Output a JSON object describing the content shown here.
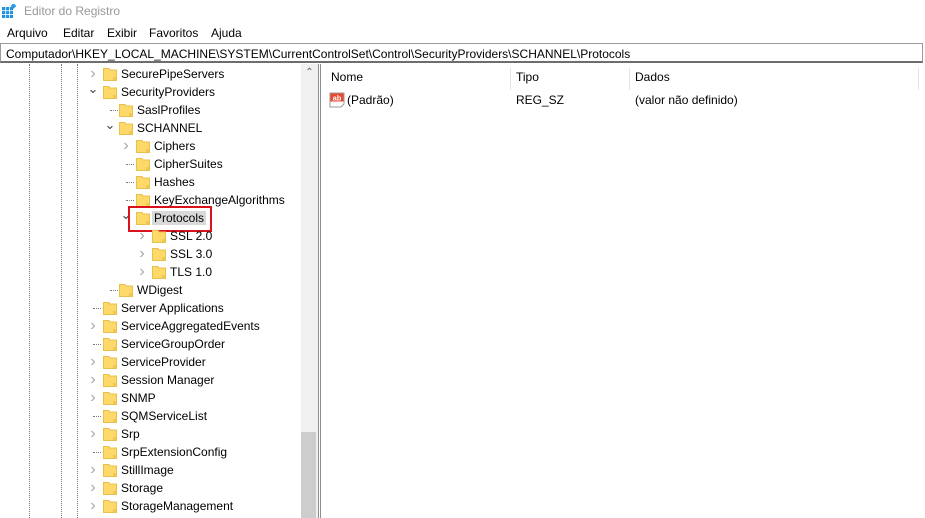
{
  "window": {
    "title": "Editor do Registro",
    "accent": "#0078d7"
  },
  "menu": [
    "Arquivo",
    "Editar",
    "Exibir",
    "Favoritos",
    "Ajuda"
  ],
  "address": "Computador\\HKEY_LOCAL_MACHINE\\SYSTEM\\CurrentControlSet\\Control\\SecurityProviders\\SCHANNEL\\Protocols",
  "tree": [
    {
      "label": "SecurePipeServers",
      "level": 0,
      "expander": "collapsed"
    },
    {
      "label": "SecurityProviders",
      "level": 0,
      "expander": "expanded"
    },
    {
      "label": "SaslProfiles",
      "level": 1,
      "expander": "none"
    },
    {
      "label": "SCHANNEL",
      "level": 1,
      "expander": "expanded"
    },
    {
      "label": "Ciphers",
      "level": 2,
      "expander": "collapsed"
    },
    {
      "label": "CipherSuites",
      "level": 2,
      "expander": "none"
    },
    {
      "label": "Hashes",
      "level": 2,
      "expander": "none"
    },
    {
      "label": "KeyExchangeAlgorithms",
      "level": 2,
      "expander": "none"
    },
    {
      "label": "Protocols",
      "level": 2,
      "expander": "expanded",
      "selected": true,
      "highlighted": true
    },
    {
      "label": "SSL 2.0",
      "level": 3,
      "expander": "collapsed"
    },
    {
      "label": "SSL 3.0",
      "level": 3,
      "expander": "collapsed"
    },
    {
      "label": "TLS 1.0",
      "level": 3,
      "expander": "collapsed"
    },
    {
      "label": "WDigest",
      "level": 1,
      "expander": "none"
    },
    {
      "label": "Server Applications",
      "level": 0,
      "expander": "none"
    },
    {
      "label": "ServiceAggregatedEvents",
      "level": 0,
      "expander": "collapsed"
    },
    {
      "label": "ServiceGroupOrder",
      "level": 0,
      "expander": "none"
    },
    {
      "label": "ServiceProvider",
      "level": 0,
      "expander": "collapsed"
    },
    {
      "label": "Session Manager",
      "level": 0,
      "expander": "collapsed"
    },
    {
      "label": "SNMP",
      "level": 0,
      "expander": "collapsed"
    },
    {
      "label": "SQMServiceList",
      "level": 0,
      "expander": "none"
    },
    {
      "label": "Srp",
      "level": 0,
      "expander": "collapsed"
    },
    {
      "label": "SrpExtensionConfig",
      "level": 0,
      "expander": "none"
    },
    {
      "label": "StillImage",
      "level": 0,
      "expander": "collapsed"
    },
    {
      "label": "Storage",
      "level": 0,
      "expander": "collapsed"
    },
    {
      "label": "StorageManagement",
      "level": 0,
      "expander": "collapsed"
    }
  ],
  "list": {
    "columns": [
      "Nome",
      "Tipo",
      "Dados"
    ],
    "rows": [
      {
        "icon": "string-value-icon",
        "name": "(Padrão)",
        "type": "REG_SZ",
        "data": "(valor não definido)"
      }
    ]
  },
  "colors": {
    "highlight_border": "#d9121c",
    "folder": "#fcd968",
    "selection": "#d9d9d9"
  }
}
